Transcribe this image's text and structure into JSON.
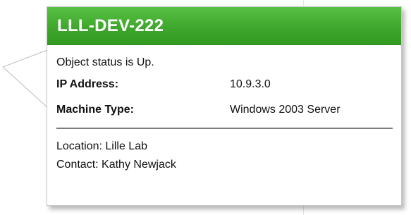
{
  "tooltip": {
    "title": "LLL-DEV-222",
    "status_text": "Object status is Up.",
    "fields": [
      {
        "label": "IP Address:",
        "value": "10.9.3.0"
      },
      {
        "label": "Machine Type:",
        "value": "Windows 2003 Server"
      }
    ],
    "location": "Location: Lille Lab",
    "contact": "Contact: Kathy Newjack"
  },
  "colors": {
    "header_green": "#3da52b",
    "header_text": "#ffffff",
    "border": "#c8c8c8",
    "divider": "#7d7d7d"
  }
}
